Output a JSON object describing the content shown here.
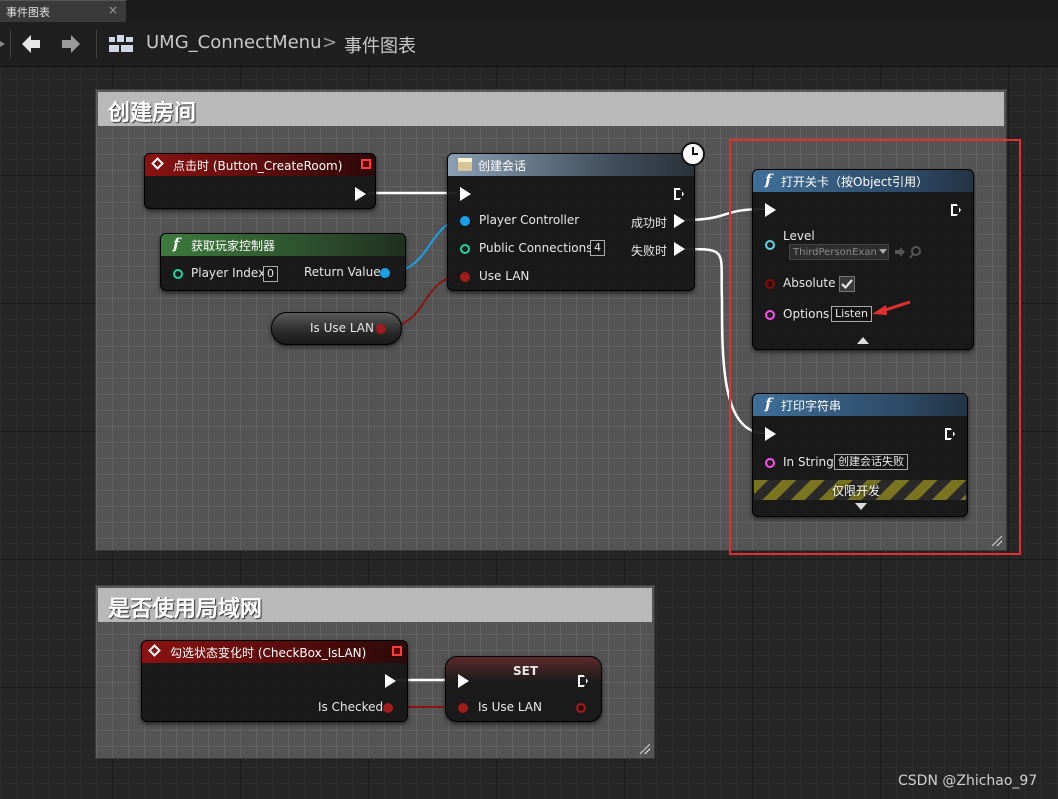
{
  "tab": {
    "label": "事件图表",
    "close": "×"
  },
  "toolbar": {
    "breadcrumb": [
      "UMG_ConnectMenu",
      "事件图表"
    ],
    "separator": ">"
  },
  "comments": [
    {
      "title": "创建房间"
    },
    {
      "title": "是否使用局域网"
    }
  ],
  "nodes": {
    "on_click": {
      "title": "点击时 (Button_CreateRoom)"
    },
    "get_player_controller": {
      "title": "获取玩家控制器",
      "player_index_label": "Player Index",
      "player_index_value": "0",
      "return_value_label": "Return Value"
    },
    "is_use_lan_var": {
      "label": "Is Use LAN"
    },
    "create_session": {
      "title": "创建会话",
      "player_controller_label": "Player Controller",
      "public_connections_label": "Public Connections",
      "public_connections_value": "4",
      "use_lan_label": "Use LAN",
      "on_success_label": "成功时",
      "on_failure_label": "失败时"
    },
    "open_level": {
      "title": "打开关卡（按Object引用）",
      "level_label": "Level",
      "level_value": "ThirdPersonExan",
      "absolute_label": "Absolute",
      "absolute_checked": true,
      "options_label": "Options",
      "options_value": "Listen"
    },
    "print_string": {
      "title": "打印字符串",
      "in_string_label": "In String",
      "in_string_value": "创建会话失败",
      "dev_only_label": "仅限开发"
    },
    "on_check_changed": {
      "title": "勾选状态变化时 (CheckBox_IsLAN)",
      "is_checked_label": "Is Checked"
    },
    "set_node": {
      "title": "SET",
      "is_use_lan_label": "Is Use LAN"
    }
  },
  "colors": {
    "exec": "#ffffff",
    "bool": "#a11c1c",
    "object": "#1aa0e6",
    "struct": "#1fd6a0",
    "string": "#ff4df0",
    "highlight": "#e03030"
  },
  "watermark": "CSDN @Zhichao_97"
}
